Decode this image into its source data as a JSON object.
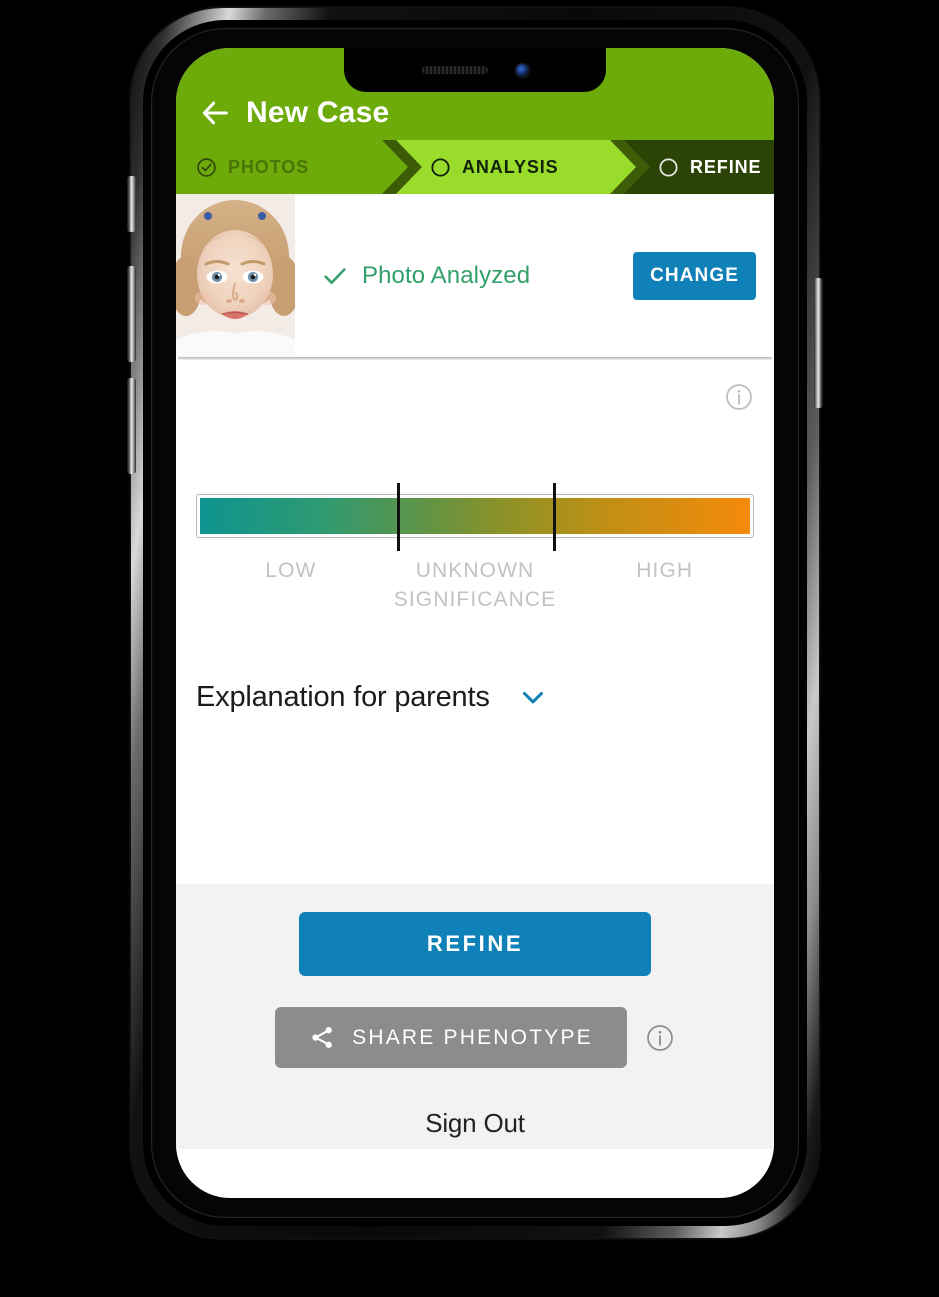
{
  "app": {
    "title": "New Case",
    "back_icon": "arrow-left-icon",
    "header_color": "#6DAB0B"
  },
  "steps": [
    {
      "label": "PHOTOS",
      "icon": "check-circle-icon",
      "state": "completed",
      "bg": "#6DAB0B",
      "text_color": "#4b7406"
    },
    {
      "label": "ANALYSIS",
      "icon": "circle-icon",
      "state": "active",
      "bg": "#9ADC2B",
      "text_color": "#12210a"
    },
    {
      "label": "REFINE",
      "icon": "circle-icon",
      "state": "upcoming",
      "bg": "#2b4405",
      "text_color": "#ffffff"
    }
  ],
  "photo_row": {
    "thumbnail_alt": "toddler-portrait-photo",
    "status_icon": "check-icon",
    "status_text": "Photo Analyzed",
    "status_color": "#33A06B",
    "change_label": "CHANGE",
    "change_color": "#1080B8"
  },
  "score": {
    "info_icon": "info-circle-icon",
    "gradient_start": "#0E9490",
    "gradient_mid": "#8E9226",
    "gradient_end": "#F58A0B",
    "marker_positions_pct": [
      36,
      64
    ],
    "labels": [
      {
        "text": "LOW",
        "position_pct": 17
      },
      {
        "text": "UNKNOWN\nSIGNIFICANCE",
        "position_pct": 50
      },
      {
        "text": "HIGH",
        "position_pct": 84
      }
    ],
    "label_color": "#c2c2c2"
  },
  "explanation": {
    "title": "Explanation for parents",
    "chevron_icon": "chevron-down-icon",
    "chevron_color": "#1080B8",
    "expanded": false
  },
  "footer": {
    "refine_label": "REFINE",
    "refine_color": "#1080B8",
    "share_label": "SHARE PHENOTYPE",
    "share_icon": "share-nodes-icon",
    "share_color": "#8C8C8C",
    "share_info_icon": "info-circle-icon",
    "signout_label": "Sign Out",
    "background": "#F2F2F2"
  }
}
